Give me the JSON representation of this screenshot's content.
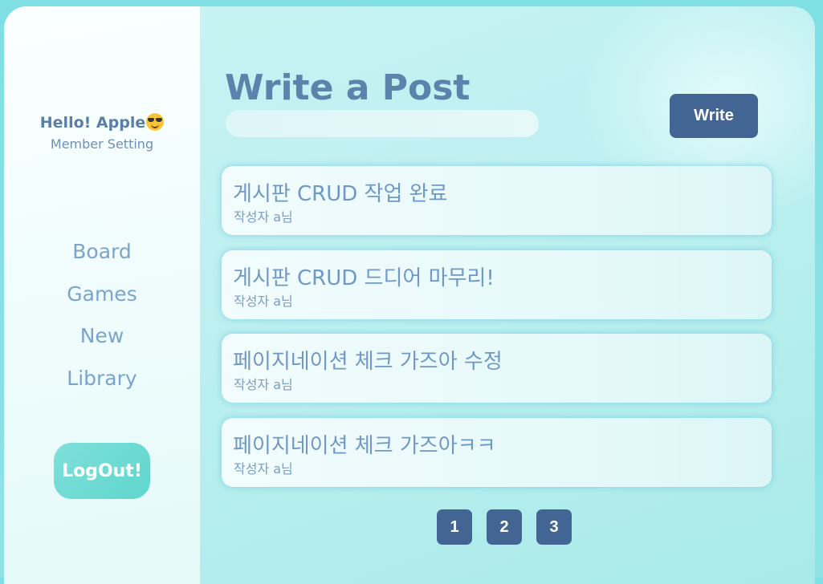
{
  "sidebar": {
    "greeting": "Hello! Apple",
    "greeting_emoji": "sunglasses-face-icon",
    "member_setting": "Member Setting",
    "nav": [
      {
        "label": "Board"
      },
      {
        "label": "Games"
      },
      {
        "label": "New"
      },
      {
        "label": "Library"
      }
    ],
    "logout": "LogOut!"
  },
  "main": {
    "title": "Write a Post",
    "title_input": {
      "value": "",
      "placeholder": ""
    },
    "write_button": "Write",
    "posts": [
      {
        "title": "게시판 CRUD 작업 완료",
        "author": "작성자 a님"
      },
      {
        "title": "게시판 CRUD 드디어 마무리!",
        "author": "작성자 a님"
      },
      {
        "title": "페이지네이션 체크 가즈아 수정",
        "author": "작성자 a님"
      },
      {
        "title": "페이지네이션 체크 가즈아ㅋㅋ",
        "author": "작성자 a님"
      }
    ],
    "pagination": [
      "1",
      "2",
      "3"
    ]
  },
  "colors": {
    "accent": "#426594",
    "title": "#5b83ac",
    "logout": "#5fd6cd"
  }
}
